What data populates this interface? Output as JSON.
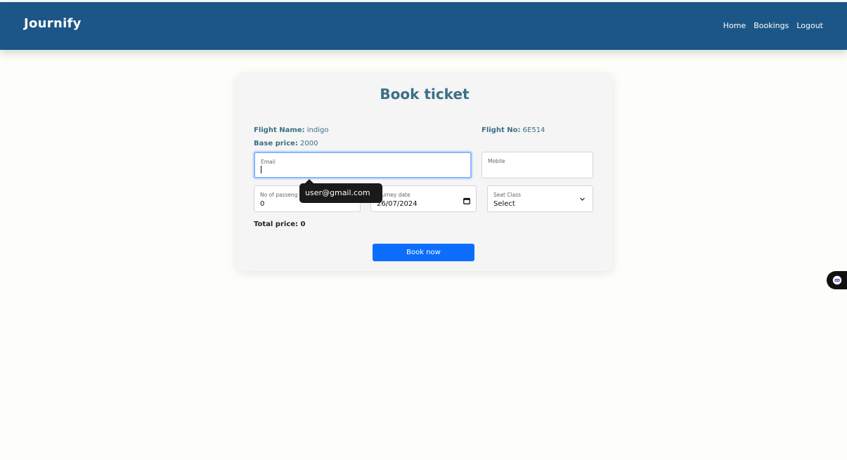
{
  "app": {
    "brand": "Journify"
  },
  "nav": {
    "items": [
      "Home",
      "Bookings",
      "Logout"
    ]
  },
  "page": {
    "title": "Book ticket"
  },
  "flight": {
    "name_label": "Flight Name:",
    "name": "indigo",
    "number_label": "Flight No:",
    "number": "6E514",
    "price_label": "Base price:",
    "price": "2000"
  },
  "form": {
    "email": {
      "label": "Email",
      "value": ""
    },
    "mobile": {
      "label": "Mobile",
      "value": ""
    },
    "passengers": {
      "label": "No of passeng",
      "value": "0"
    },
    "journey_date": {
      "label": "Journey date",
      "value": "26/07/2024"
    },
    "seat_class": {
      "label": "Seat Class",
      "value": "Select"
    }
  },
  "autofill": {
    "suggestion": "user@gmail.com"
  },
  "total": {
    "label": "Total price:",
    "value": "0"
  },
  "actions": {
    "book_label": "Book now"
  },
  "colors": {
    "navbar": "#1c5687",
    "accent": "#0d6efd",
    "title": "#3d6f86"
  },
  "icons": {
    "calendar": "calendar-icon",
    "chevron": "chevron-down-icon",
    "assistant": "bot-icon"
  }
}
